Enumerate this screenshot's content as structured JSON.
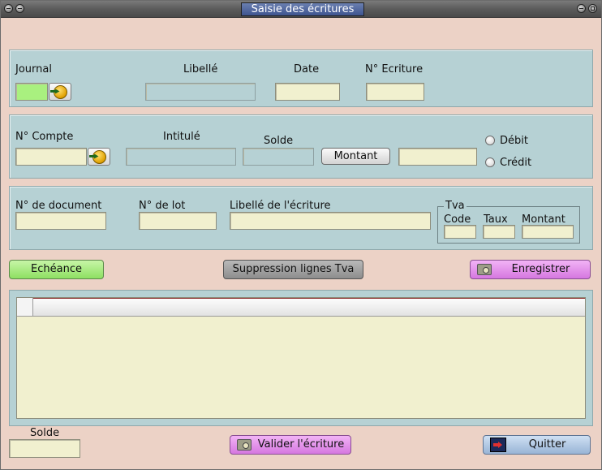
{
  "window": {
    "title": "Saisie des écritures"
  },
  "header_section": {
    "journal_label": "Journal",
    "libelle_label": "Libellé",
    "date_label": "Date",
    "ecriture_label": "N° Ecriture"
  },
  "compte_section": {
    "compte_label": "N° Compte",
    "intitule_label": "Intitulé",
    "solde_label": "Solde",
    "montant_button": "Montant",
    "debit_label": "Débit",
    "credit_label": "Crédit"
  },
  "document_section": {
    "document_label": "N° de document",
    "lot_label": "N° de lot",
    "libelle_ecriture_label": "Libellé de l'écriture",
    "tva": {
      "title": "Tva",
      "code_label": "Code",
      "taux_label": "Taux",
      "montant_label": "Montant"
    }
  },
  "actions": {
    "echeance": "Echéance",
    "suppression": "Suppression lignes Tva",
    "enregistrer": "Enregistrer"
  },
  "footer": {
    "solde_label": "Solde",
    "valider": "Valider l'écriture",
    "quitter": "Quitter"
  },
  "colors": {
    "window_bg": "#ecd2c6",
    "group_bg": "#b6d1d4",
    "field_bg": "#f1f0cf",
    "journal_field_bg": "#a9f07f"
  },
  "icons": {
    "journal_lookup": "arrow-disc-icon",
    "compte_lookup": "arrow-disc-icon",
    "enregistrer": "camera-icon",
    "valider": "camera-icon",
    "quitter": "exit-icon"
  }
}
